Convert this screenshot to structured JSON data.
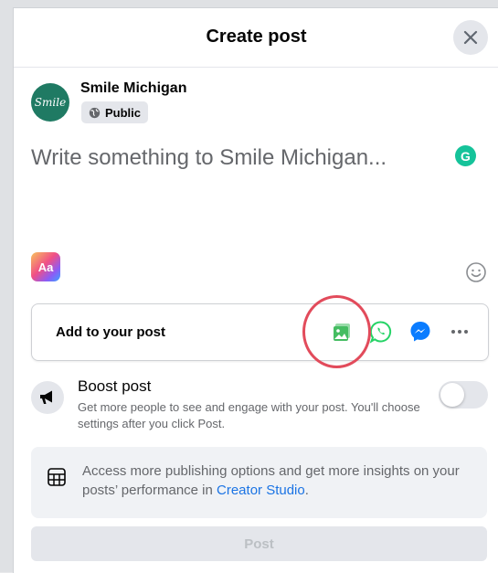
{
  "dialog": {
    "title": "Create post"
  },
  "author": {
    "name": "Smile Michigan",
    "avatar_text": "Smile",
    "privacy": "Public"
  },
  "composer": {
    "placeholder": "Write something to Smile Michigan..."
  },
  "style_button": "Aa",
  "add_to_post": {
    "label": "Add to your post",
    "icons": [
      "photo-video-icon",
      "whatsapp-icon",
      "messenger-icon",
      "more-icon"
    ]
  },
  "boost": {
    "title": "Boost post",
    "description": "Get more people to see and engage with your post. You'll choose settings after you click Post.",
    "enabled": false
  },
  "info": {
    "text": "Access more publishing options and get more insights on your posts’ performance in ",
    "link": "Creator Studio",
    "suffix": "."
  },
  "post_button": "Post",
  "colors": {
    "accent": "#1b74e4",
    "highlight_circle": "#e24b5b",
    "photo_green": "#45bd62",
    "whatsapp_green": "#25d366",
    "messenger_blue": "#0a7cff"
  }
}
